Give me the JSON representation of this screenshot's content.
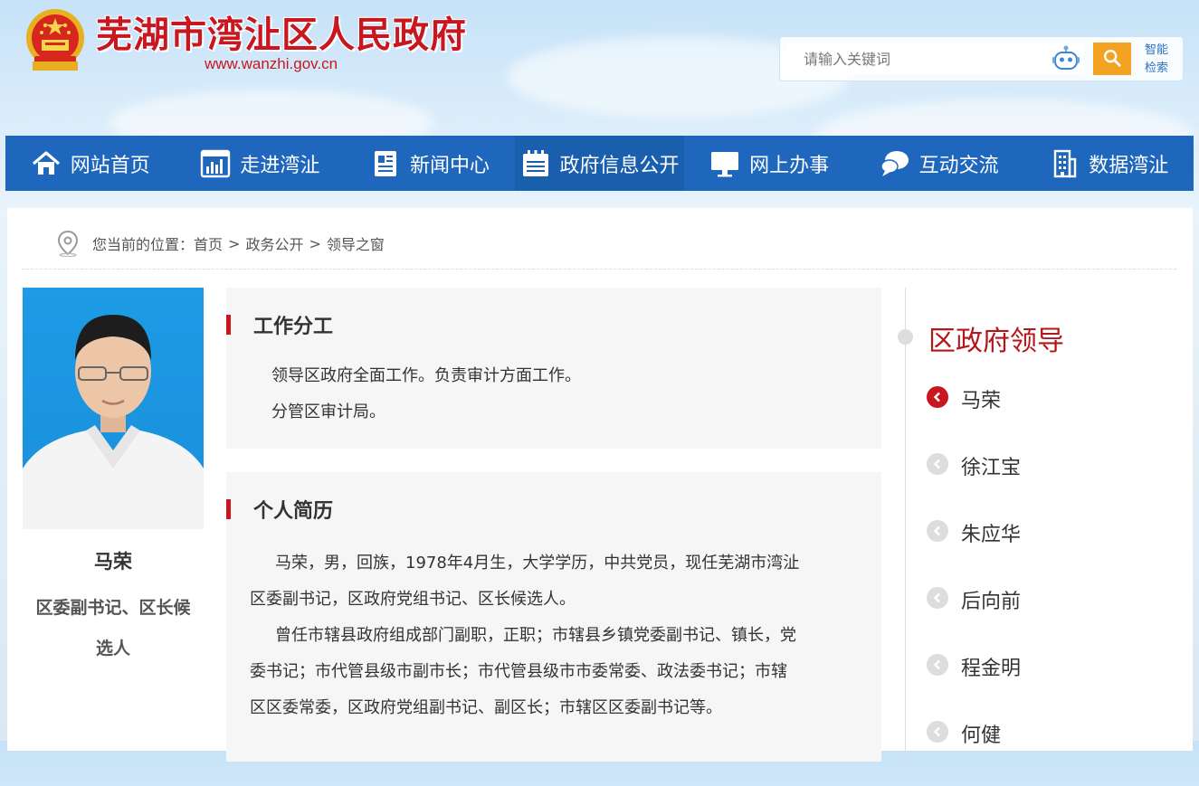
{
  "header": {
    "site_title": "芜湖市湾沚区人民政府",
    "site_url": "www.wanzhi.gov.cn",
    "search_placeholder": "请输入关键词",
    "smart_search_line1": "智能",
    "smart_search_line2": "检索"
  },
  "nav": [
    {
      "label": "网站首页",
      "icon": "home-icon"
    },
    {
      "label": "走进湾沚",
      "icon": "chart-icon"
    },
    {
      "label": "新闻中心",
      "icon": "news-icon"
    },
    {
      "label": "政府信息公开",
      "icon": "calendar-icon",
      "active": true
    },
    {
      "label": "网上办事",
      "icon": "monitor-icon"
    },
    {
      "label": "互动交流",
      "icon": "chat-icon"
    },
    {
      "label": "数据湾沚",
      "icon": "building-icon"
    }
  ],
  "breadcrumb": {
    "prefix": "您当前的位置：",
    "items": [
      "首页",
      "政务公开",
      "领导之窗"
    ],
    "separator": ">"
  },
  "leader": {
    "name": "马荣",
    "title_line1": "区委副书记、区长候",
    "title_line2": "选人"
  },
  "work": {
    "heading": "工作分工",
    "lines": [
      "领导区政府全面工作。负责审计方面工作。",
      "分管区审计局。"
    ]
  },
  "resume": {
    "heading": "个人简历",
    "lines": [
      "马荣，男，回族，1978年4月生，大学学历，中共党员，现任芜湖市湾沚",
      "区委副书记，区政府党组书记、区长候选人。",
      "曾任市辖县政府组成部门副职，正职；市辖县乡镇党委副书记、镇长，党",
      "委书记；市代管县级市副市长；市代管县级市市委常委、政法委书记；市辖",
      "区区委常委，区政府党组副书记、副区长；市辖区区委副书记等。"
    ]
  },
  "sidebar": {
    "title": "区政府领导",
    "items": [
      {
        "label": "马荣",
        "active": true
      },
      {
        "label": "徐江宝"
      },
      {
        "label": "朱应华"
      },
      {
        "label": "后向前"
      },
      {
        "label": "程金明"
      },
      {
        "label": "何健"
      }
    ]
  },
  "colors": {
    "brand_red": "#c8171e",
    "nav_blue": "#1e67bd",
    "search_orange": "#f3a221"
  }
}
